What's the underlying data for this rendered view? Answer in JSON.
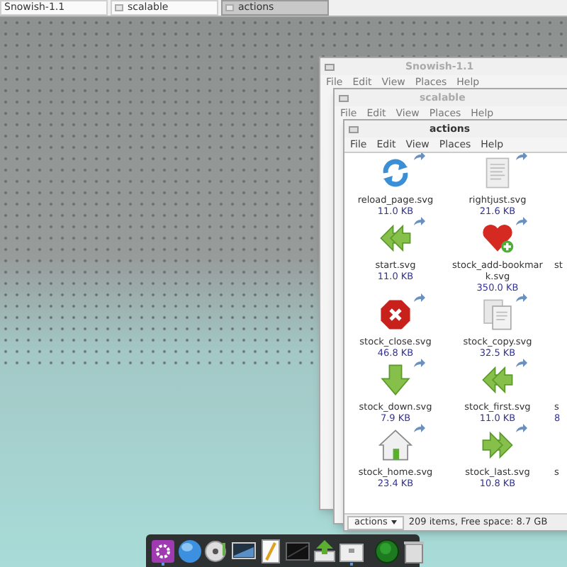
{
  "taskbar": {
    "tasks": [
      {
        "label": "Snowish-1.1",
        "selected": false
      },
      {
        "label": "scalable",
        "selected": false
      },
      {
        "label": "actions",
        "selected": true
      }
    ]
  },
  "windows": [
    {
      "title": "Snowish-1.1",
      "menu": [
        "File",
        "Edit",
        "View",
        "Places",
        "Help"
      ]
    },
    {
      "title": "scalable",
      "menu": [
        "File",
        "Edit",
        "View",
        "Places",
        "Help"
      ]
    },
    {
      "title": "actions",
      "menu": [
        "File",
        "Edit",
        "View",
        "Places",
        "Help"
      ],
      "rows": [
        [
          {
            "kind": "refresh",
            "name": "reload_page.svg",
            "size": "11.0 KB"
          },
          {
            "kind": "document",
            "name": "rightjust.svg",
            "size": "21.6 KB"
          }
        ],
        [
          {
            "kind": "back",
            "name": "start.svg",
            "size": "11.0 KB"
          },
          {
            "kind": "heart",
            "name": "stock_add-bookmark.svg",
            "size": "350.0 KB"
          },
          {
            "kind": "cut",
            "name": "st"
          }
        ],
        [
          {
            "kind": "stop",
            "name": "stock_close.svg",
            "size": "46.8 KB"
          },
          {
            "kind": "copy",
            "name": "stock_copy.svg",
            "size": "32.5 KB"
          }
        ],
        [
          {
            "kind": "down",
            "name": "stock_down.svg",
            "size": "7.9 KB"
          },
          {
            "kind": "back",
            "name": "stock_first.svg",
            "size": "11.0 KB"
          },
          {
            "kind": "cut",
            "name": "s",
            "size": "8"
          }
        ],
        [
          {
            "kind": "home",
            "name": "stock_home.svg",
            "size": "23.4 KB"
          },
          {
            "kind": "forward",
            "name": "stock_last.svg",
            "size": "10.8 KB"
          },
          {
            "kind": "cut",
            "name": "s"
          }
        ]
      ],
      "location": "actions",
      "status": "209 items, Free space: 8.7 GB"
    }
  ],
  "dock": {
    "items": [
      {
        "kind": "settings",
        "running": true
      },
      {
        "kind": "globe",
        "running": false
      },
      {
        "kind": "disc",
        "running": false
      },
      {
        "kind": "monitor",
        "running": false
      },
      {
        "kind": "notepad",
        "running": false
      },
      {
        "kind": "terminal",
        "running": false
      },
      {
        "kind": "upload",
        "running": false
      },
      {
        "kind": "folder",
        "running": true
      },
      {
        "kind": "record",
        "running": false
      },
      {
        "kind": "trash",
        "running": false
      }
    ]
  }
}
